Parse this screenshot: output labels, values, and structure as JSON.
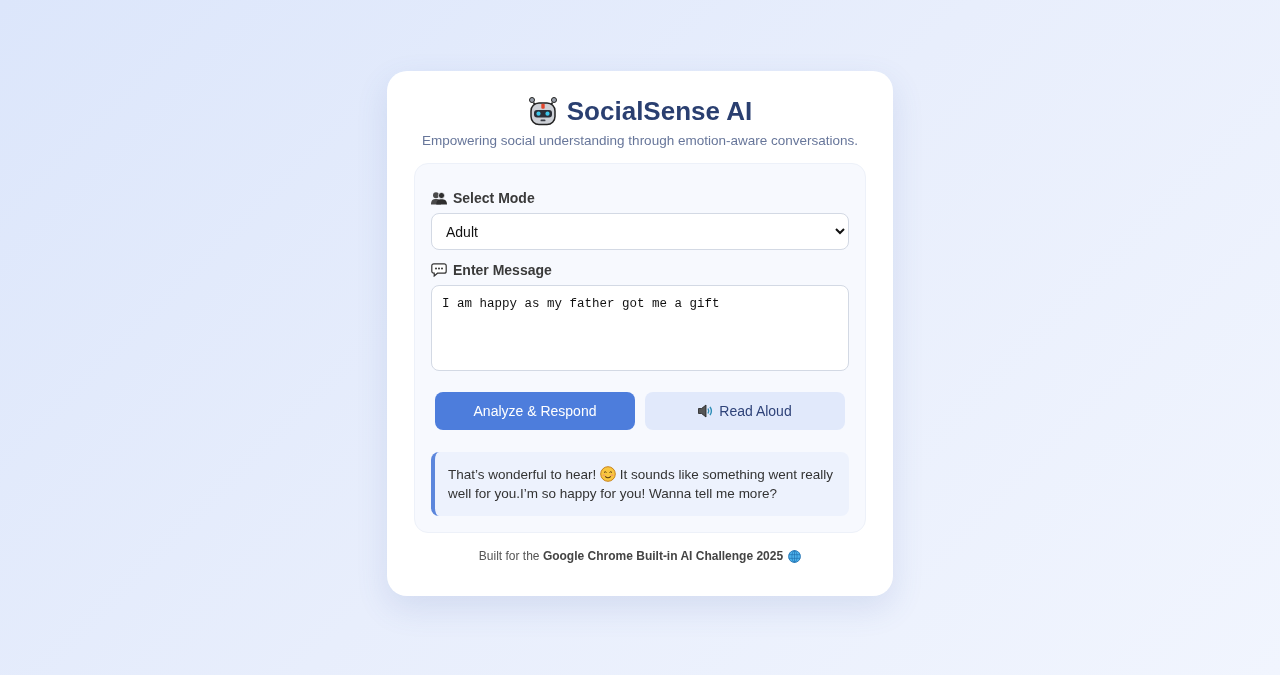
{
  "header": {
    "title": "SocialSense AI",
    "subtitle": "Empowering social understanding through emotion-aware conversations."
  },
  "form": {
    "mode": {
      "label": "Select Mode",
      "value": "Adult"
    },
    "message": {
      "label": "Enter Message",
      "value": "I am happy as my father got me a gift"
    },
    "buttons": [
      {
        "kind": "primary",
        "label": "Analyze & Respond"
      },
      {
        "kind": "speak",
        "label": "Read Aloud"
      }
    ],
    "response": {
      "lead": "That’s wonderful to hear!",
      "body": "It sounds like something went really well for you.I’m so happy for you! Wanna tell me more?"
    }
  },
  "footer": {
    "text": "Built for the **Google Chrome Built-in AI Challenge 2025**"
  }
}
